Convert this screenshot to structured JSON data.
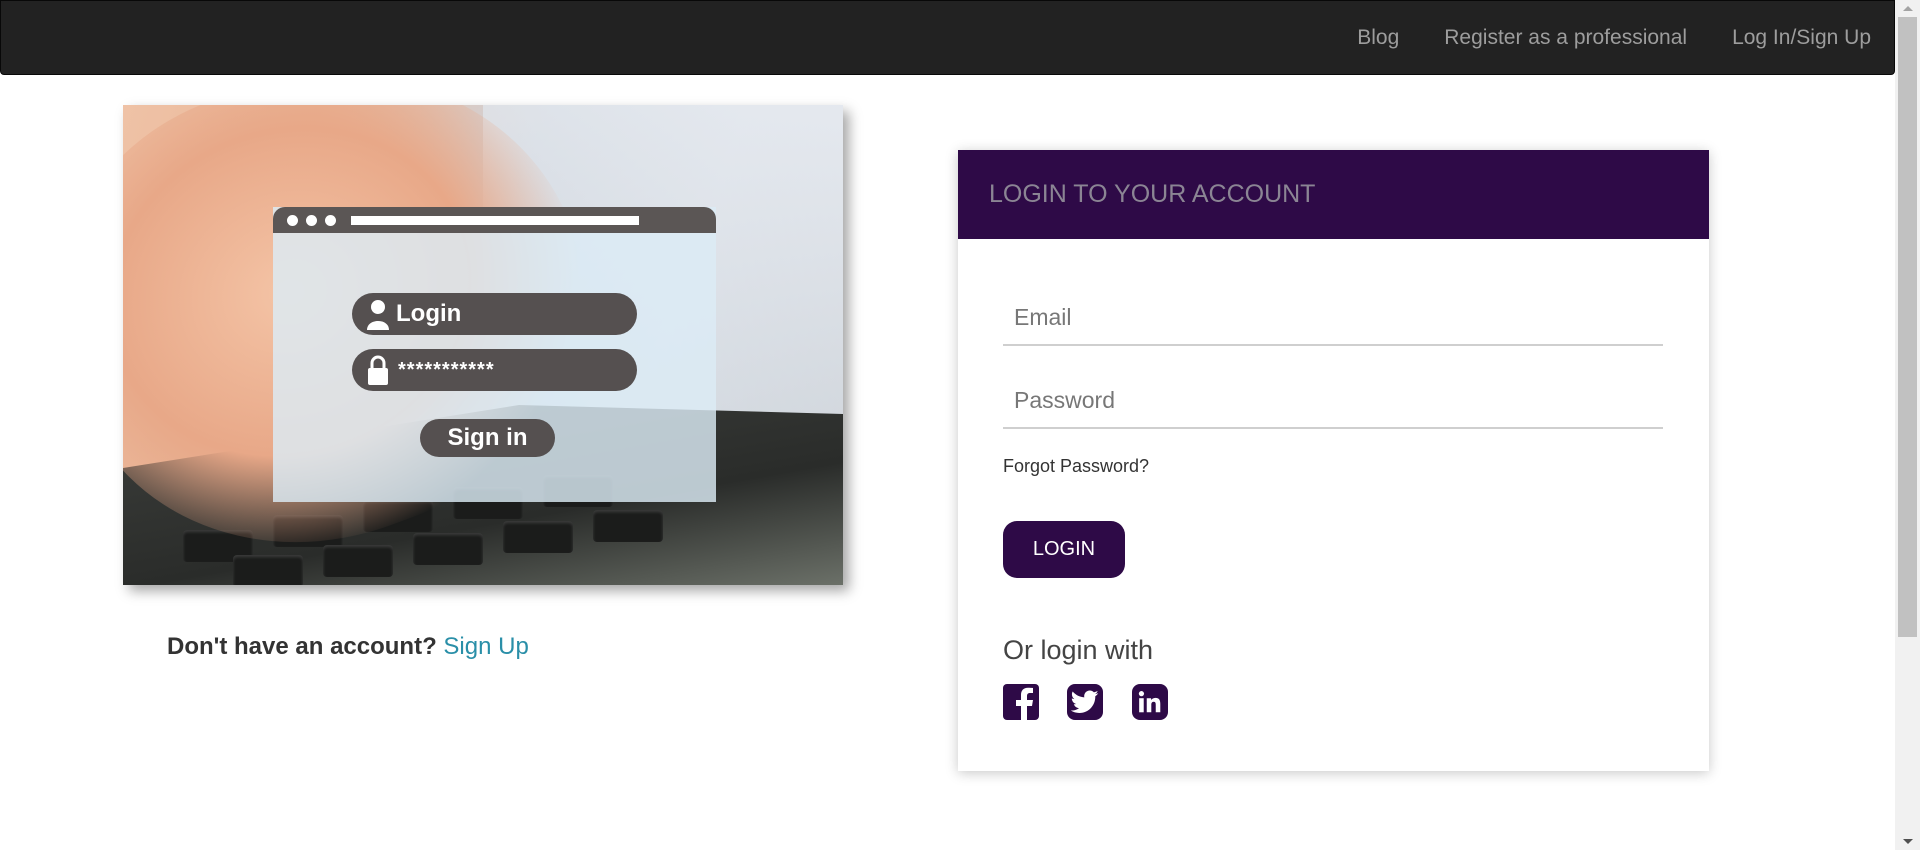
{
  "navbar": {
    "links": [
      {
        "label": "Blog"
      },
      {
        "label": "Register as a professional"
      },
      {
        "label": "Log In/Sign Up"
      }
    ]
  },
  "hero": {
    "illustration": {
      "login_field": "Login",
      "password_field": "***********",
      "signin_button": "Sign in"
    }
  },
  "signup": {
    "question": "Don't have an account?",
    "link": "Sign Up"
  },
  "login_card": {
    "title": "LOGIN TO YOUR ACCOUNT",
    "email_placeholder": "Email",
    "password_placeholder": "Password",
    "forgot_password": "Forgot Password?",
    "login_button": "LOGIN",
    "or_login_with": "Or login with",
    "social": [
      {
        "name": "facebook-icon"
      },
      {
        "name": "twitter-icon"
      },
      {
        "name": "linkedin-icon"
      }
    ]
  },
  "colors": {
    "brand": "#2e0a47",
    "navbar_bg": "#222222",
    "nav_text": "#9d9d9d",
    "link": "#2a8fa8"
  }
}
